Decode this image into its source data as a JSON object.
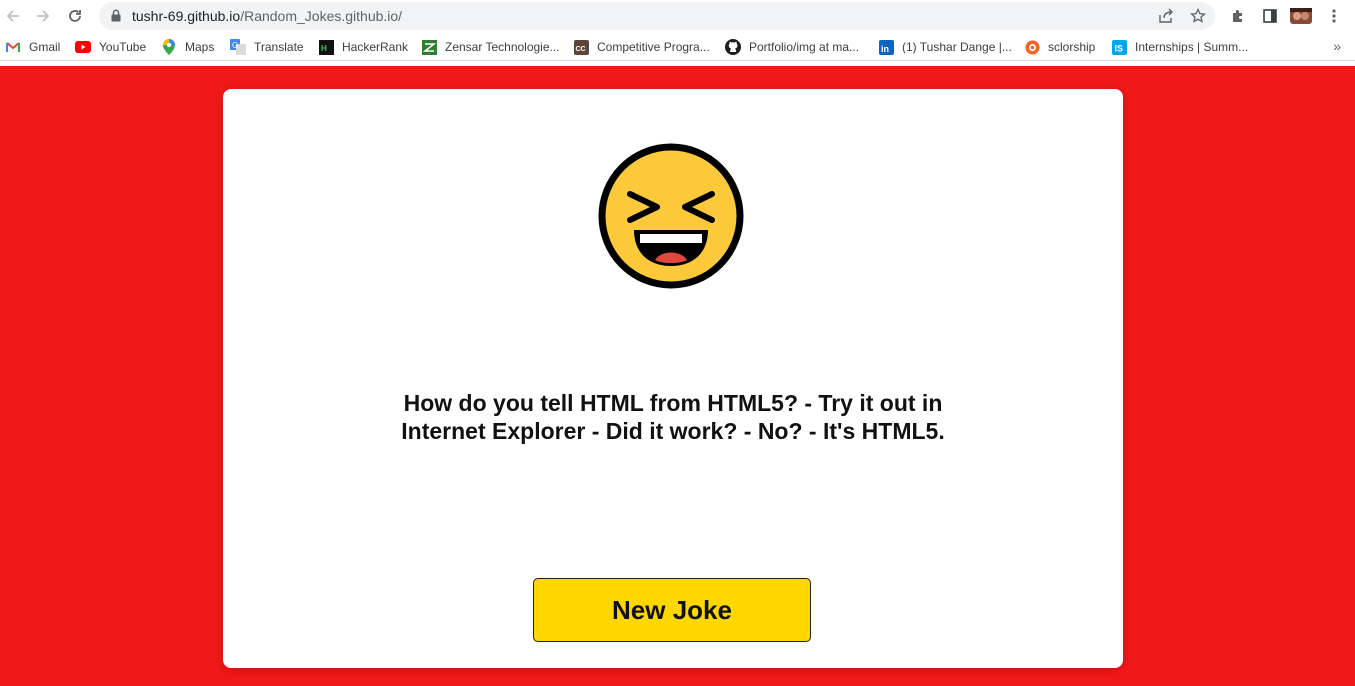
{
  "browser": {
    "url_domain": "tushr-69.github.io",
    "url_path": "/Random_Jokes.github.io/",
    "icons": [
      "back-icon",
      "forward-icon",
      "reload-icon",
      "lock-icon",
      "share-icon",
      "star-icon",
      "extensions-icon",
      "side-panel-icon",
      "profile-avatar",
      "menu-icon"
    ]
  },
  "bookmarks": [
    {
      "label": "Gmail",
      "icon": "gmail-icon"
    },
    {
      "label": "YouTube",
      "icon": "youtube-icon"
    },
    {
      "label": "Maps",
      "icon": "maps-icon"
    },
    {
      "label": "Translate",
      "icon": "translate-icon"
    },
    {
      "label": "HackerRank",
      "icon": "hackerrank-icon"
    },
    {
      "label": "Zensar Technologie...",
      "icon": "zensar-icon"
    },
    {
      "label": "Competitive Progra...",
      "icon": "codechef-icon"
    },
    {
      "label": "Portfolio/img at ma...",
      "icon": "github-icon"
    },
    {
      "label": "(1) Tushar Dange |...",
      "icon": "linkedin-icon"
    },
    {
      "label": "sclorship",
      "icon": "sclorship-icon"
    },
    {
      "label": "Internships | Summ...",
      "icon": "internshala-icon"
    }
  ],
  "bookmarks_more": "»",
  "page": {
    "background_color": "#f01818",
    "emoji": "laughing-face-icon",
    "joke_line1": "How do you tell HTML from HTML5? - Try it out in",
    "joke_line2": "Internet Explorer - Did it work? - No? - It's HTML5.",
    "button_label": "New Joke",
    "button_color": "#ffd700"
  }
}
